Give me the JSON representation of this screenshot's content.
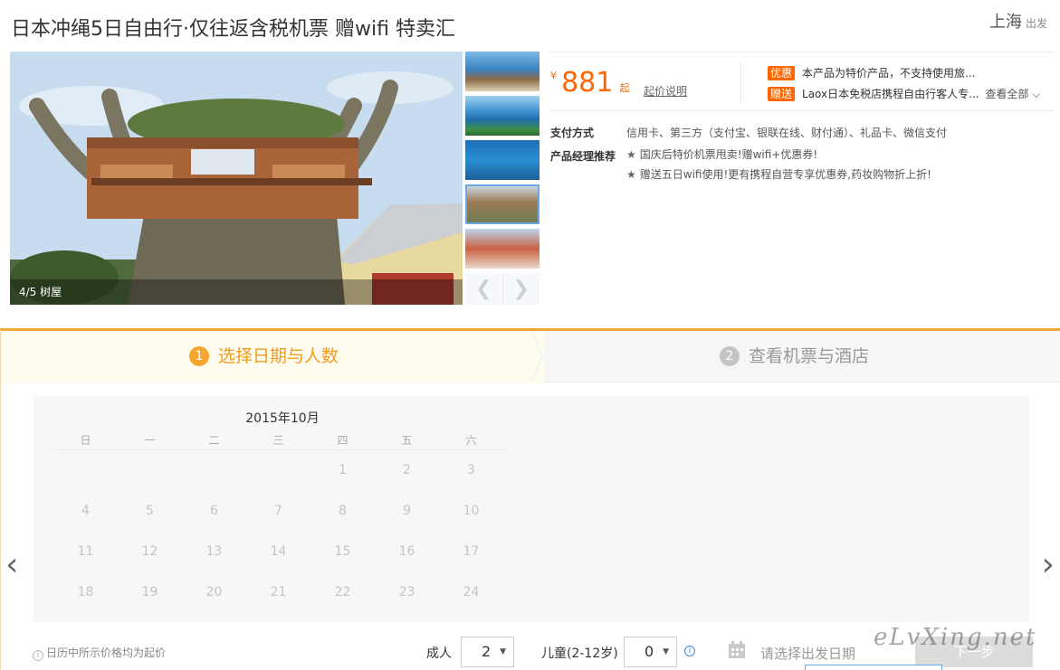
{
  "product": {
    "title": "日本冲绳5日自由行·仅往返含税机票 赠wifi 特卖汇",
    "tag": "特卖汇",
    "departure_city": "上海",
    "departure_label": "出发"
  },
  "gallery": {
    "caption": "4/5 树屋",
    "prev_glyph": "❮",
    "next_glyph": "❯"
  },
  "pricing": {
    "currency": "¥",
    "price": "881",
    "from": "起",
    "price_note_link": "起价说明"
  },
  "promotions": [
    {
      "badge": "优惠",
      "text": "本产品为特价产品，不支持使用旅..."
    },
    {
      "badge": "赠送",
      "text": "Laox日本免税店携程自由行客人专...",
      "more": "查看全部"
    }
  ],
  "details": {
    "payment_label": "支付方式",
    "payment_value": "信用卡、第三方（支付宝、银联在线、财付通）、礼品卡、微信支付",
    "manager_label": "产品经理推荐",
    "recommendations": [
      "国庆后特价机票甩卖!赠wifi+优惠券!",
      "赠送五日wifi使用!更有携程自营专享优惠券,药妆购物折上折!"
    ]
  },
  "booking": {
    "steps": [
      {
        "number": "1",
        "label": "选择日期与人数"
      },
      {
        "number": "2",
        "label": "查看机票与酒店"
      }
    ],
    "calendar": {
      "month": "2015年10月",
      "weekdays": [
        "日",
        "一",
        "二",
        "三",
        "四",
        "五",
        "六"
      ],
      "first_weekday": 4,
      "days": 24
    },
    "price_tip": "日历中所示价格均为起价",
    "adults_label": "成人",
    "adults_value": "2",
    "children_label": "儿童(2-12岁)",
    "children_value": "0",
    "date_placeholder": "请选择出发日期",
    "next_button": "下一步"
  },
  "watermark": "eLvXing.net",
  "colors": {
    "accent_orange": "#ff6600",
    "step_active": "#f29b1e"
  }
}
